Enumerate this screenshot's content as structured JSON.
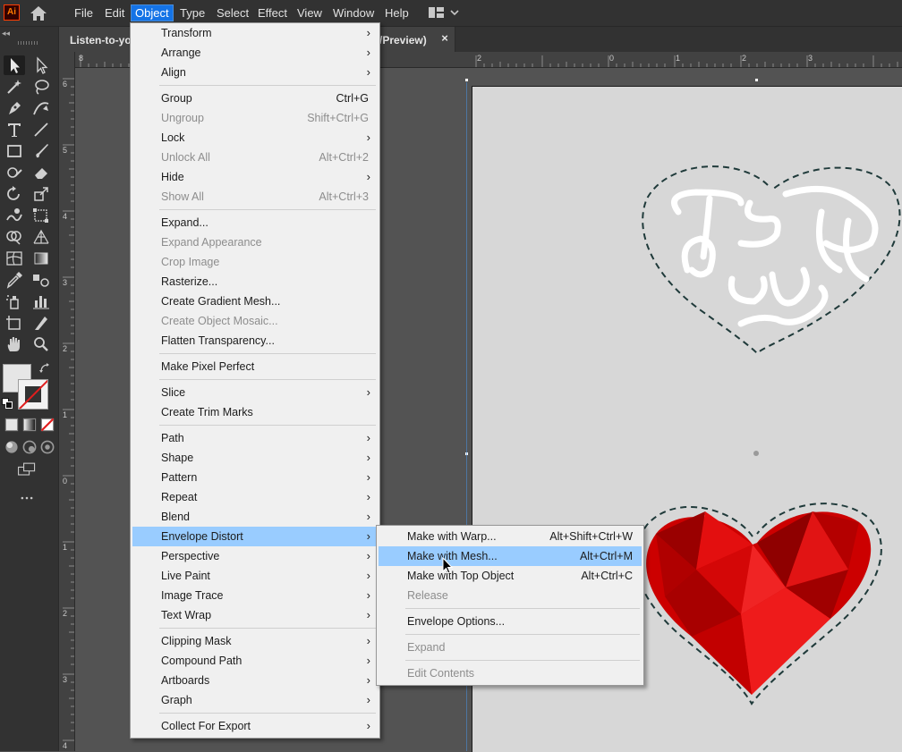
{
  "app": {
    "logo_text": "Ai"
  },
  "menubar": {
    "items": [
      "File",
      "Edit",
      "Object",
      "Type",
      "Select",
      "Effect",
      "View",
      "Window",
      "Help"
    ],
    "active": "Object"
  },
  "tab": {
    "label_start": "Listen-to-you",
    "label_end": "/Preview)",
    "close": "×"
  },
  "ruler_h": [
    "8",
    "2",
    "0",
    "1",
    "2",
    "3"
  ],
  "ruler_v": [
    "6",
    "5",
    "4",
    "3",
    "2",
    "1",
    "0",
    "1",
    "2",
    "3",
    "4"
  ],
  "object_menu": {
    "items": [
      {
        "label": "Transform",
        "submenu": true
      },
      {
        "label": "Arrange",
        "submenu": true
      },
      {
        "label": "Align",
        "submenu": true
      },
      {
        "sep": true
      },
      {
        "label": "Group",
        "shortcut": "Ctrl+G"
      },
      {
        "label": "Ungroup",
        "shortcut": "Shift+Ctrl+G",
        "disabled": true
      },
      {
        "label": "Lock",
        "submenu": true
      },
      {
        "label": "Unlock All",
        "shortcut": "Alt+Ctrl+2",
        "disabled": true
      },
      {
        "label": "Hide",
        "submenu": true
      },
      {
        "label": "Show All",
        "shortcut": "Alt+Ctrl+3",
        "disabled": true
      },
      {
        "sep": true
      },
      {
        "label": "Expand..."
      },
      {
        "label": "Expand Appearance",
        "disabled": true
      },
      {
        "label": "Crop Image",
        "disabled": true
      },
      {
        "label": "Rasterize..."
      },
      {
        "label": "Create Gradient Mesh..."
      },
      {
        "label": "Create Object Mosaic...",
        "disabled": true
      },
      {
        "label": "Flatten Transparency..."
      },
      {
        "sep": true
      },
      {
        "label": "Make Pixel Perfect"
      },
      {
        "sep": true
      },
      {
        "label": "Slice",
        "submenu": true
      },
      {
        "label": "Create Trim Marks"
      },
      {
        "sep": true
      },
      {
        "label": "Path",
        "submenu": true
      },
      {
        "label": "Shape",
        "submenu": true
      },
      {
        "label": "Pattern",
        "submenu": true
      },
      {
        "label": "Repeat",
        "submenu": true
      },
      {
        "label": "Blend",
        "submenu": true
      },
      {
        "label": "Envelope Distort",
        "submenu": true,
        "highlighted": true
      },
      {
        "label": "Perspective",
        "submenu": true
      },
      {
        "label": "Live Paint",
        "submenu": true
      },
      {
        "label": "Image Trace",
        "submenu": true
      },
      {
        "label": "Text Wrap",
        "submenu": true
      },
      {
        "sep": true
      },
      {
        "label": "Clipping Mask",
        "submenu": true
      },
      {
        "label": "Compound Path",
        "submenu": true
      },
      {
        "label": "Artboards",
        "submenu": true
      },
      {
        "label": "Graph",
        "submenu": true
      },
      {
        "sep": true
      },
      {
        "label": "Collect For Export",
        "submenu": true
      }
    ]
  },
  "envelope_submenu": {
    "items": [
      {
        "label": "Make with Warp...",
        "shortcut": "Alt+Shift+Ctrl+W"
      },
      {
        "label": "Make with Mesh...",
        "shortcut": "Alt+Ctrl+M",
        "highlighted": true
      },
      {
        "label": "Make with Top Object",
        "shortcut": "Alt+Ctrl+C"
      },
      {
        "label": "Release",
        "disabled": true
      },
      {
        "sep": true
      },
      {
        "label": "Envelope Options..."
      },
      {
        "sep": true
      },
      {
        "label": "Expand",
        "disabled": true
      },
      {
        "sep": true
      },
      {
        "label": "Edit Contents",
        "disabled": true
      }
    ]
  },
  "colors": {
    "highlight": "#99ccff",
    "menu_bg": "#f0f0f0",
    "heart_red": "#cc0000",
    "app_accent": "#ff7b00"
  },
  "artwork": {
    "hand_lettering_text": "Listen to your heart"
  }
}
